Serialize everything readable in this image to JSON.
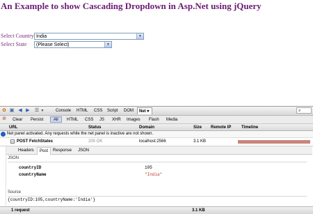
{
  "page": {
    "title": "An Example to show Cascading Dropdown in Asp.Net using jQuery",
    "country_label": "Select Country",
    "country_value": "India",
    "state_label": "Select State",
    "state_value": "(Please Select)"
  },
  "firebug": {
    "toolbar_tabs": [
      "Console",
      "HTML",
      "CSS",
      "Script",
      "DOM",
      "Net"
    ],
    "net_tab_arrow": "▾",
    "filter_items": [
      "Clear",
      "Persist",
      "All",
      "HTML",
      "CSS",
      "JS",
      "XHR",
      "Images",
      "Flash",
      "Media"
    ],
    "columns": [
      "URL",
      "Status",
      "Domain",
      "Size",
      "Remote IP",
      "Timeline"
    ],
    "notice": "Net panel activated. Any requests while the net panel is inactive are not shown.",
    "request": {
      "expander": "–",
      "url": "POST FetchStates",
      "status": "200 OK",
      "domain": "localhost:2566",
      "size": "3.1 KB"
    },
    "detail_tabs": [
      "Headers",
      "Post",
      "Response",
      "JSON"
    ],
    "json_title": "JSON",
    "json_fields": [
      {
        "key": "countryID",
        "value": "105"
      },
      {
        "key": "countryName",
        "value": "\"India\""
      }
    ],
    "source_title": "Source",
    "source_text": "{countryID:105,countryName:'India'}",
    "footer": {
      "requests": "1 request",
      "size": "3.1 KB"
    }
  },
  "colors": {
    "title": "#6a1b75",
    "string_value": "#c0392b",
    "timeline": "#c9857a"
  }
}
